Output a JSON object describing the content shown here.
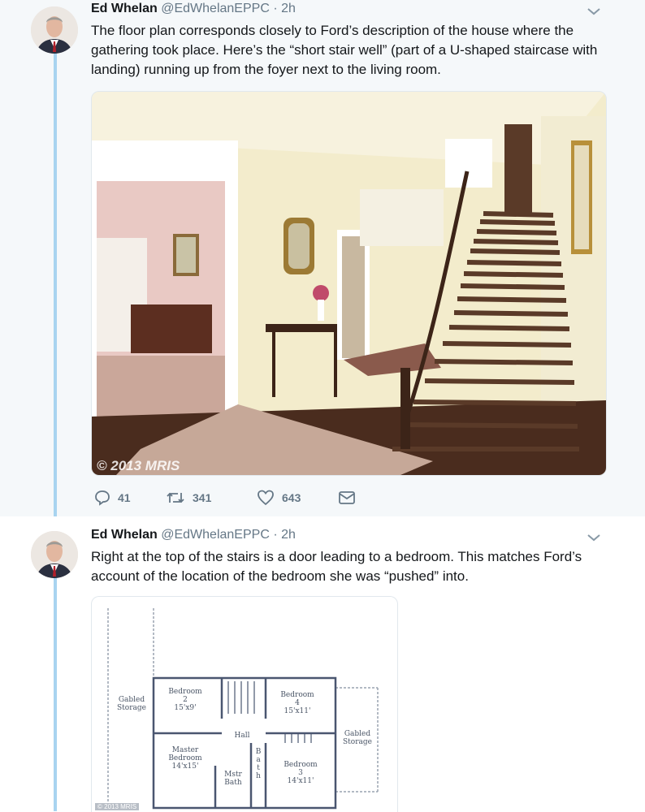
{
  "tweets": [
    {
      "author_name": "Ed Whelan",
      "handle": "@EdWhelanEPPC",
      "time": "· 2h",
      "text": "The floor plan corresponds closely to Ford’s description of the house where the gathering took place. Here’s the “short stair well” (part of a U-shaped staircase with landing) running up from the foyer next to the living room.",
      "image_watermark": "© 2013 MRIS",
      "replies": "41",
      "retweets": "341",
      "likes": "643"
    },
    {
      "author_name": "Ed Whelan",
      "handle": "@EdWhelanEPPC",
      "time": "· 2h",
      "text": "Right at the top of the stairs is a door leading to a bedroom. This matches Ford’s account of the location of the bedroom she was “pushed” into.",
      "floorplan": {
        "gabled_left": "Gabled\nStorage",
        "bedroom2": "Bedroom\n2\n15'x9'",
        "bedroom4": "Bedroom\n4\n15'x11'",
        "hall": "Hall",
        "gabled_right": "Gabled\nStorage",
        "master": "Master\nBedroom\n14'x15'",
        "mstr_bath": "Mstr\nBath",
        "bath": "B\na\nt\nh",
        "bedroom3": "Bedroom\n3\n14'x11'",
        "watermark": "© 2013 MRIS"
      }
    }
  ],
  "colors": {
    "thread_line": "#a8d4f0",
    "secondary_text": "#657786",
    "card_bg": "#f5f8fa"
  },
  "icons": [
    "reply-icon",
    "retweet-icon",
    "like-icon",
    "dm-icon",
    "chevron-down-icon"
  ]
}
